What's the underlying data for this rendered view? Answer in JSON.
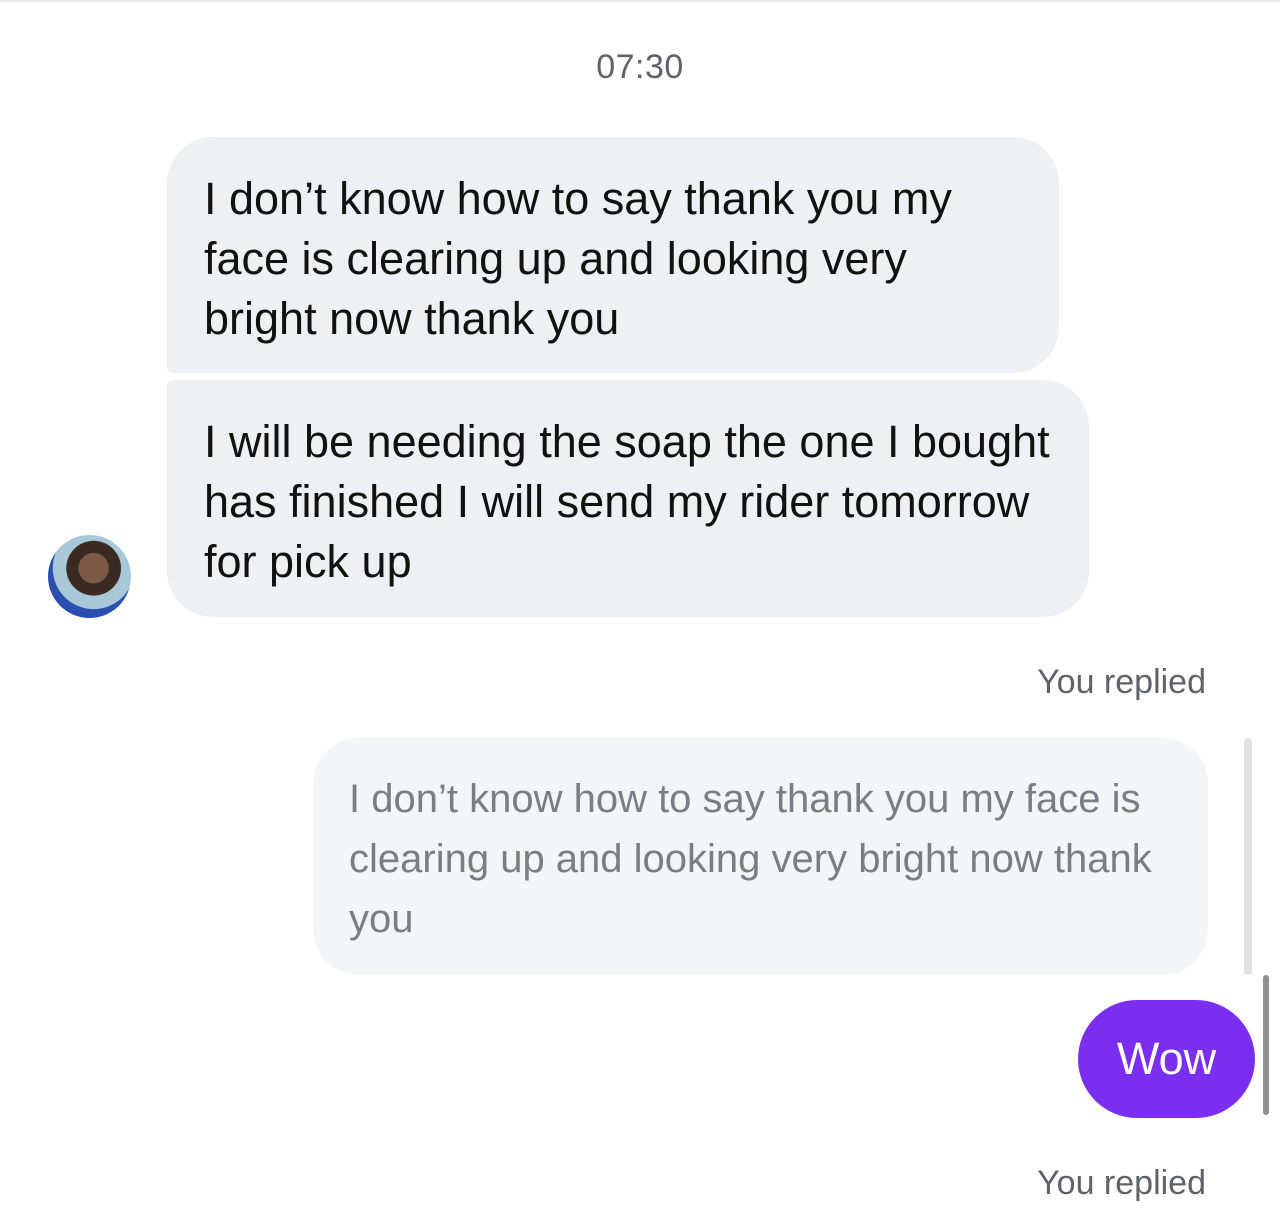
{
  "conversation": {
    "timestamp": "07:30",
    "incoming_messages": [
      {
        "text": "I don’t know how to say thank you my face is clearing up and looking very bright now thank you"
      },
      {
        "text": "I will be needing the soap the one I bought has finished I will send my rider tomorrow for pick up"
      }
    ],
    "reply_label_1": "You replied",
    "quoted_message": "I don’t know how to say thank you my face is clearing up and looking very bright now thank you",
    "outgoing_message": "Wow",
    "reply_label_2": "You replied"
  },
  "colors": {
    "incoming_bubble": "#eef0f3",
    "quoted_bubble": "#f4f5f7",
    "outgoing_bubble": "#7a2ff0",
    "meta_text": "#5f6368"
  },
  "icons": {
    "avatar": "contact-avatar"
  }
}
